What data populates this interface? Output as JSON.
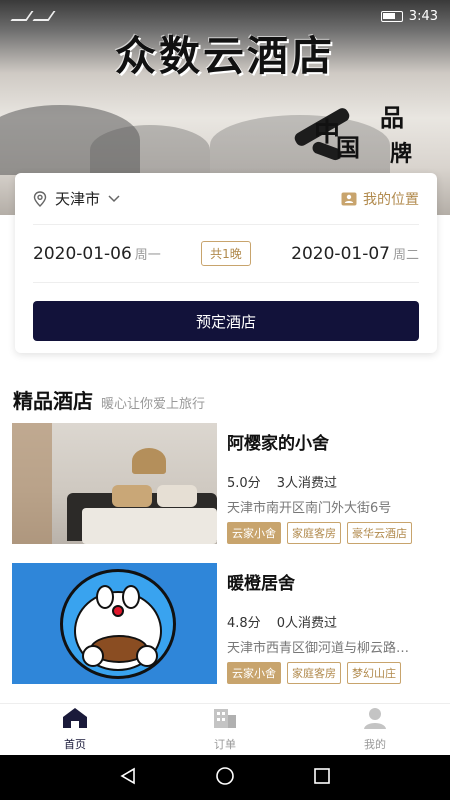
{
  "status_bar": {
    "time": "3:43"
  },
  "hero": {
    "title": "众数云酒店",
    "emblem_chars": [
      "中",
      "国",
      "品",
      "牌"
    ]
  },
  "booking": {
    "city": "天津市",
    "my_location": "我的位置",
    "checkin_date": "2020-01-06",
    "checkin_weekday": "周一",
    "nights": "共1晚",
    "checkout_date": "2020-01-07",
    "checkout_weekday": "周二",
    "book_button": "预定酒店"
  },
  "section": {
    "title": "精品酒店",
    "subtitle": "暖心让你爱上旅行"
  },
  "hotels": [
    {
      "name": "阿樱家的小舍",
      "score": "5.0分",
      "consumers": "3人消费过",
      "address": "天津市南开区南门外大街6号",
      "tags": [
        "云家小舍",
        "家庭客房",
        "豪华云酒店"
      ]
    },
    {
      "name": "暖橙居舍",
      "score": "4.8分",
      "consumers": "0人消费过",
      "address": "天津市西青区御河道与柳云路…",
      "tags": [
        "云家小舍",
        "家庭客房",
        "梦幻山庄"
      ]
    }
  ],
  "tabbar": [
    {
      "label": "首页",
      "icon": "home-icon",
      "active": true
    },
    {
      "label": "订单",
      "icon": "building-icon",
      "active": false
    },
    {
      "label": "我的",
      "icon": "user-icon",
      "active": false
    }
  ],
  "colors": {
    "accent_gold": "#b18a4d",
    "primary_navy": "#12123a"
  }
}
